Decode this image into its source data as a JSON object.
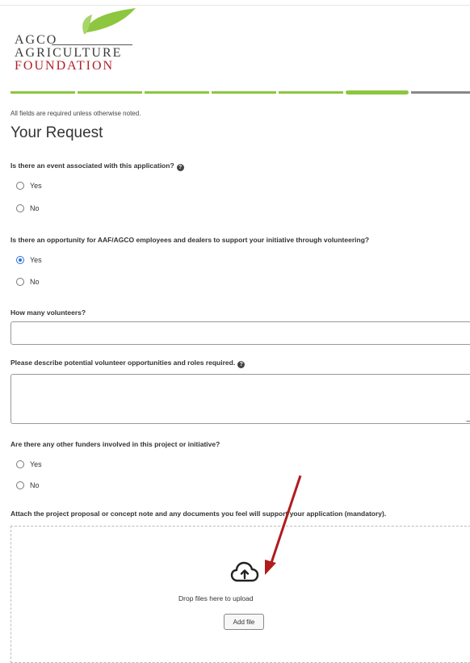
{
  "logo": {
    "line1": "AGCO",
    "line2": "AGRICULTURE",
    "line3": "FOUNDATION"
  },
  "progress": {
    "total_steps": 7,
    "current_step": 6
  },
  "form": {
    "note": "All fields are required unless otherwise noted.",
    "title": "Your Request",
    "q1": {
      "label": "Is there an event associated with this application?",
      "options": [
        "Yes",
        "No"
      ],
      "selected": null
    },
    "q2": {
      "label": "Is there an opportunity for AAF/AGCO employees and dealers to support your initiative through volunteering?",
      "options": [
        "Yes",
        "No"
      ],
      "selected": "Yes"
    },
    "q3": {
      "label": "How many volunteers?",
      "value": ""
    },
    "q4": {
      "label": "Please describe potential volunteer opportunities and roles required.",
      "value": ""
    },
    "q5": {
      "label": "Are there any other funders involved in this project or initiative?",
      "options": [
        "Yes",
        "No"
      ],
      "selected": null
    },
    "upload": {
      "label": "Attach the project proposal or concept note and any documents you feel will support your application (mandatory).",
      "drop_text": "Drop files here to upload",
      "button": "Add file"
    }
  },
  "icons": {
    "help": "question-circle-icon",
    "upload": "cloud-upload-icon"
  },
  "colors": {
    "progress_done": "#8dc63f",
    "progress_todo": "#888888",
    "radio_selected": "#2a6fdb",
    "annotation_arrow": "#b01c1c",
    "logo_red": "#b0202a"
  }
}
